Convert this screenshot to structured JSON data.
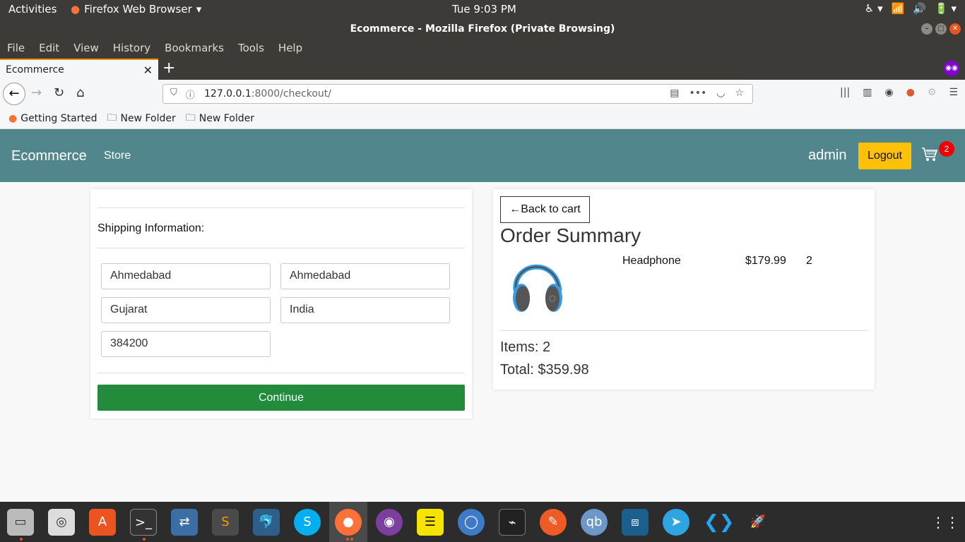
{
  "system": {
    "activities": "Activities",
    "app_name": "Firefox Web Browser",
    "clock": "Tue  9:03 PM"
  },
  "window": {
    "title": "Ecommerce - Mozilla Firefox (Private Browsing)"
  },
  "menu": [
    "File",
    "Edit",
    "View",
    "History",
    "Bookmarks",
    "Tools",
    "Help"
  ],
  "tab": {
    "label": "Ecommerce"
  },
  "url": {
    "host": "127.0.0.1",
    "path": ":8000/checkout/"
  },
  "bookmarks": [
    "Getting Started",
    "New Folder",
    "New Folder"
  ],
  "site": {
    "brand": "Ecommerce",
    "store_link": "Store",
    "user": "admin",
    "logout": "Logout",
    "cart_count": "2"
  },
  "shipping": {
    "title": "Shipping Information:",
    "fields": {
      "address": "Ahmedabad",
      "city": "Ahmedabad",
      "state": "Gujarat",
      "country": "India",
      "zipcode": "384200"
    },
    "continue": "Continue"
  },
  "summary": {
    "back": "←Back to cart",
    "title": "Order Summary",
    "items": [
      {
        "name": "Headphone",
        "price": "$179.99",
        "qty": "2"
      }
    ],
    "items_count": "Items: 2",
    "total": "Total: $359.98"
  }
}
